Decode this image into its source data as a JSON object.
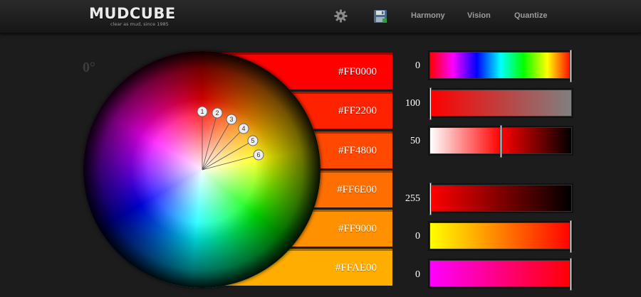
{
  "header": {
    "logo_text": "MUDCUBE",
    "logo_tagline": "clear as mud, since 1985",
    "nav": [
      {
        "label": "Harmony"
      },
      {
        "label": "Vision"
      },
      {
        "label": "Quantize"
      }
    ]
  },
  "wheel": {
    "angle_label": "0°",
    "handles": [
      "1",
      "2",
      "3",
      "4",
      "5",
      "6"
    ]
  },
  "colors": [
    {
      "hex": "#FF0000",
      "color": "#FF0000"
    },
    {
      "hex": "#FF2200",
      "color": "#FF2200"
    },
    {
      "hex": "#FF4800",
      "color": "#FF4800"
    },
    {
      "hex": "#FF6E00",
      "color": "#FF6E00"
    },
    {
      "hex": "#FF9000",
      "color": "#FF9000"
    },
    {
      "hex": "#FFAE00",
      "color": "#FFAE00"
    }
  ],
  "sliders": [
    {
      "label": "0",
      "value_fraction": 1.0,
      "kind": "hue"
    },
    {
      "label": "100",
      "value_fraction": 0.0,
      "kind": "saturation"
    },
    {
      "label": "50",
      "value_fraction": 0.5,
      "kind": "lightness"
    },
    {
      "label": "255",
      "value_fraction": 0.0,
      "kind": "red"
    },
    {
      "label": "0",
      "value_fraction": 1.0,
      "kind": "green"
    },
    {
      "label": "0",
      "value_fraction": 1.0,
      "kind": "blue"
    }
  ],
  "icons": {
    "settings": "gear-icon",
    "save": "save-icon"
  }
}
